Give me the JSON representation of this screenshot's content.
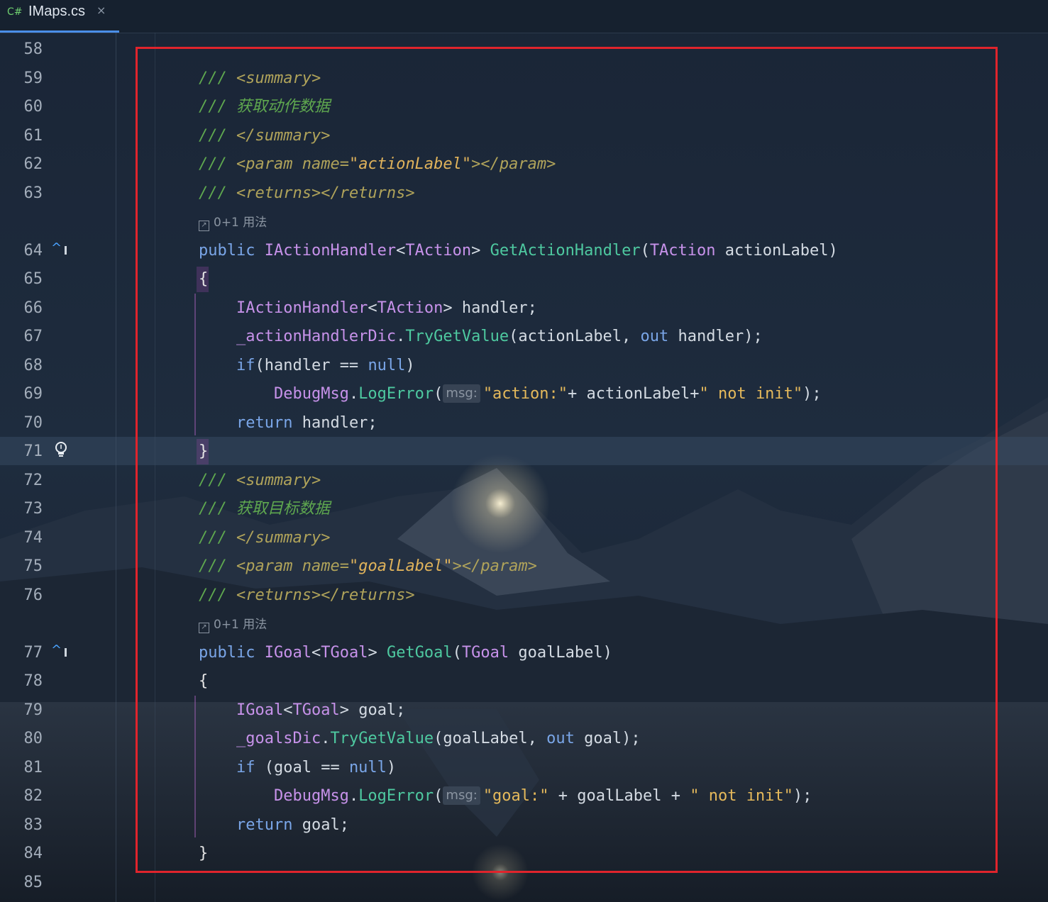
{
  "tab": {
    "lang_badge": "C#",
    "file_name": "IMaps.cs",
    "close_glyph": "×"
  },
  "usages_hint": "0+1 用法",
  "param_hint_label": "msg:",
  "line_numbers": [
    "58",
    "59",
    "60",
    "61",
    "62",
    "63",
    "64",
    "65",
    "66",
    "67",
    "68",
    "69",
    "70",
    "71",
    "72",
    "73",
    "74",
    "75",
    "76",
    "77",
    "78",
    "79",
    "80",
    "81",
    "82",
    "83",
    "84",
    "85"
  ],
  "code": {
    "l59": {
      "doc": "///",
      "tag": "<summary>"
    },
    "l60": {
      "doc": "/// 获取动作数据"
    },
    "l61": {
      "doc": "///",
      "tag": "</summary>"
    },
    "l62": {
      "doc": "///",
      "tag_open": "<param",
      "attr": "name=",
      "value": "\"actionLabel\"",
      "tag_close": "></param>"
    },
    "l63": {
      "doc": "///",
      "tag": "<returns></returns>"
    },
    "l64": {
      "kw": "public",
      "ret_type": "IActionHandler",
      "lt": "<",
      "gen": "TAction",
      "gt": ">",
      "fn": "GetActionHandler",
      "open": "(",
      "ptype": "TAction",
      "pname": "actionLabel",
      "close": ")"
    },
    "l65": {
      "text": "{"
    },
    "l66": {
      "type": "IActionHandler",
      "lt": "<",
      "gen": "TAction",
      "gt": ">",
      "rest": " handler;"
    },
    "l67": {
      "field": "_actionHandlerDic",
      "dot": ".",
      "fn": "TryGetValue",
      "args1": "(actionLabel, ",
      "kw": "out",
      "args2": " handler);"
    },
    "l68": {
      "kw": "if",
      "mid": "(handler == ",
      "kw2": "null",
      "end": ")"
    },
    "l69": {
      "cls": "DebugMsg",
      "dot": ".",
      "fn": "LogError",
      "open": "(",
      "str1": "\"action:\"",
      "mid": "+ actionLabel+",
      "str2": "\" not init\"",
      "end": ");"
    },
    "l70": {
      "kw": "return",
      "rest": " handler;"
    },
    "l71": {
      "text": "}"
    },
    "l72": {
      "doc": "///",
      "tag": "<summary>"
    },
    "l73": {
      "doc": "/// 获取目标数据"
    },
    "l74": {
      "doc": "///",
      "tag": "</summary>"
    },
    "l75": {
      "doc": "///",
      "tag_open": "<param",
      "attr": "name=",
      "value": "\"goalLabel\"",
      "tag_close": "></param>"
    },
    "l76": {
      "doc": "///",
      "tag": "<returns></returns>"
    },
    "l77": {
      "kw": "public",
      "ret_type": "IGoal",
      "lt": "<",
      "gen": "TGoal",
      "gt": ">",
      "fn": "GetGoal",
      "open": "(",
      "ptype": "TGoal",
      "pname": "goalLabel",
      "close": ")"
    },
    "l78": {
      "text": "{"
    },
    "l79": {
      "type": "IGoal",
      "lt": "<",
      "gen": "TGoal",
      "gt": ">",
      "rest": " goal;"
    },
    "l80": {
      "field": "_goalsDic",
      "dot": ".",
      "fn": "TryGetValue",
      "args1": "(goalLabel, ",
      "kw": "out",
      "args2": " goal);"
    },
    "l81": {
      "kw": "if",
      "mid": " (goal == ",
      "kw2": "null",
      "end": ")"
    },
    "l82": {
      "cls": "DebugMsg",
      "dot": ".",
      "fn": "LogError",
      "open": "(",
      "str1": "\"goal:\"",
      "mid": " + goalLabel + ",
      "str2": "\" not init\"",
      "end": ");"
    },
    "l83": {
      "kw": "return",
      "rest": " goal;"
    },
    "l84": {
      "text": "}"
    }
  },
  "colors": {
    "highlight_border": "#e0242c",
    "doc_comment": "#5fa84f",
    "keyword": "#7aa6e8",
    "type": "#c792ea",
    "method": "#4ec9a0",
    "string": "#e5b95b",
    "tab_underline": "#4a8ee8"
  }
}
